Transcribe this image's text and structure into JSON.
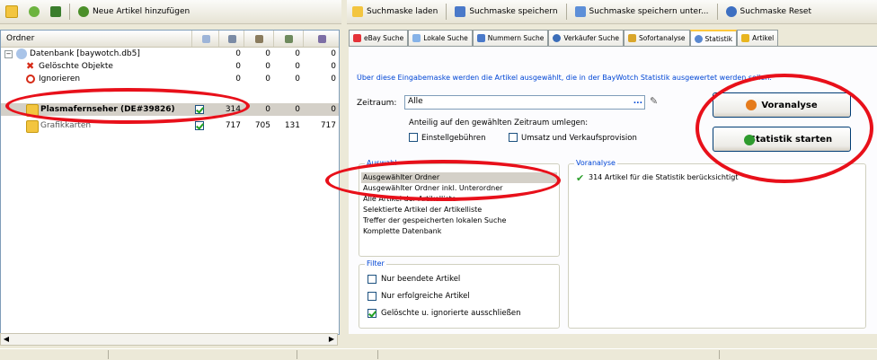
{
  "toolbar_left": {
    "new_article_label": "Neue Artikel hinzufügen"
  },
  "toolbar_right": {
    "load_mask": "Suchmaske laden",
    "save_mask": "Suchmaske speichern",
    "save_mask_as": "Suchmaske speichern unter...",
    "reset_mask": "Suchmaske Reset"
  },
  "grid": {
    "header_folder": "Ordner",
    "rows": [
      {
        "label": "Datenbank [baywotch.db5]",
        "c2": "0",
        "c3": "0",
        "c4": "0",
        "c5": "0",
        "checked": false
      },
      {
        "label": "Gelöschte Objekte",
        "c2": "0",
        "c3": "0",
        "c4": "0",
        "c5": "0",
        "checked": false
      },
      {
        "label": "Ignorieren",
        "c2": "0",
        "c3": "0",
        "c4": "0",
        "c5": "0",
        "checked": false
      },
      {
        "label": "Plasmafernseher (DE#39826)",
        "c2": "314",
        "c3": "0",
        "c4": "0",
        "c5": "0",
        "checked": true
      },
      {
        "label": "Grafikkarten",
        "c2": "717",
        "c3": "705",
        "c4": "131",
        "c5": "717",
        "checked": true
      }
    ]
  },
  "tabs": [
    {
      "label": "eBay Suche",
      "icon": "ebay-icon"
    },
    {
      "label": "Lokale Suche",
      "icon": "local-search-icon"
    },
    {
      "label": "Nummern Suche",
      "icon": "number-search-icon"
    },
    {
      "label": "Verkäufer Suche",
      "icon": "seller-search-icon"
    },
    {
      "label": "Sofortanalyse",
      "icon": "analysis-icon"
    },
    {
      "label": "Statistik",
      "icon": "statistics-icon"
    },
    {
      "label": "Artikel",
      "icon": "lock-icon"
    }
  ],
  "panel": {
    "description": "Über diese Eingabemaske werden die Artikel ausgewählt, die in der BayWotch Statistik ausgewertet werden sollen.",
    "zeitraum_label": "Zeitraum:",
    "zeitraum_value": "Alle",
    "zeitraum_button": "...",
    "anteilig_label": "Anteilig auf den gewählten Zeitraum umlegen:",
    "opt_einstellgebuehren": "Einstellgebühren",
    "opt_umsatz": "Umsatz und Verkaufsprovision",
    "voranalyse_button": "Voranalyse",
    "statistik_button": "Statistik starten",
    "auswahl_title": "Auswahl",
    "auswahl_items": [
      "Ausgewählter Ordner",
      "Ausgewählter Ordner inkl. Unterordner",
      "Alle Artikel der Artikelliste",
      "Selektierte Artikel der Artikelliste",
      "Treffer der gespeicherten lokalen Suche",
      "Komplette Datenbank"
    ],
    "voranalyse_title": "Voranalyse",
    "voranalyse_result": "314 Artikel für die Statistik berücksichtigt",
    "filter_title": "Filter",
    "filter_items": [
      {
        "label": "Nur beendete Artikel",
        "checked": false
      },
      {
        "label": "Nur erfolgreiche Artikel",
        "checked": false
      },
      {
        "label": "Gelöschte u. ignorierte ausschließen",
        "checked": true
      }
    ]
  },
  "colors": {
    "highlight_red": "#e8101a",
    "selection": "#d4d0c8",
    "link_blue": "#0046d5"
  }
}
